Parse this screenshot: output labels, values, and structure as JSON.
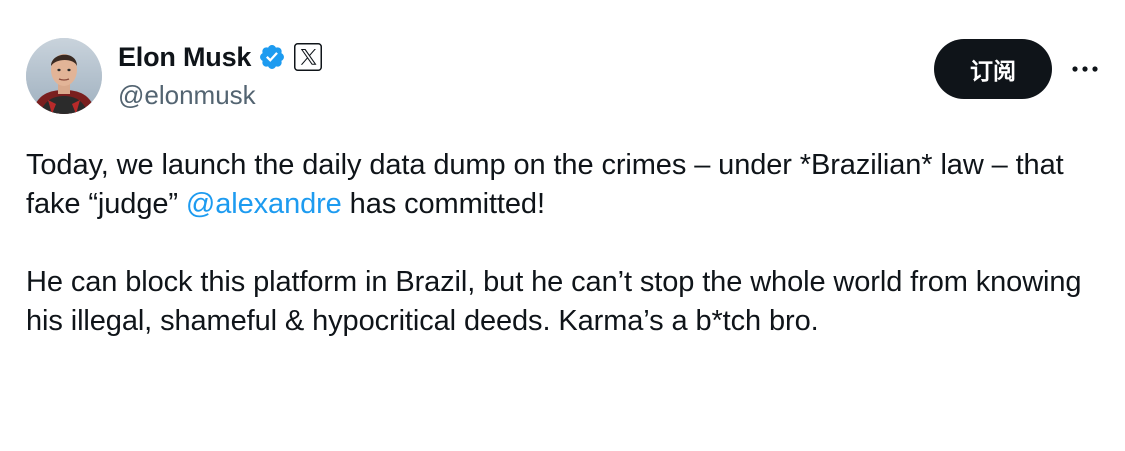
{
  "author": {
    "display_name": "Elon Musk",
    "handle": "@elonmusk",
    "verified_icon": "verified-badge-icon",
    "affiliation_icon": "x-logo-icon",
    "avatar": "profile-avatar"
  },
  "actions": {
    "subscribe_label": "订阅",
    "more_icon": "more-horizontal-icon"
  },
  "tweet": {
    "para1_before_mention": "Today, we launch the daily data dump on the crimes – under *Brazilian* law – that fake “judge” ",
    "mention": "@alexandre",
    "para1_after_mention": " has committed!",
    "para2": "He can block this platform in Brazil, but he can’t stop the whole world from knowing his illegal, shameful & hypocritical deeds. Karma’s a b*tch bro."
  },
  "colors": {
    "text": "#0f1419",
    "secondary": "#536471",
    "link": "#1d9bf0",
    "button_bg": "#0f1419",
    "verified": "#1d9bf0"
  }
}
